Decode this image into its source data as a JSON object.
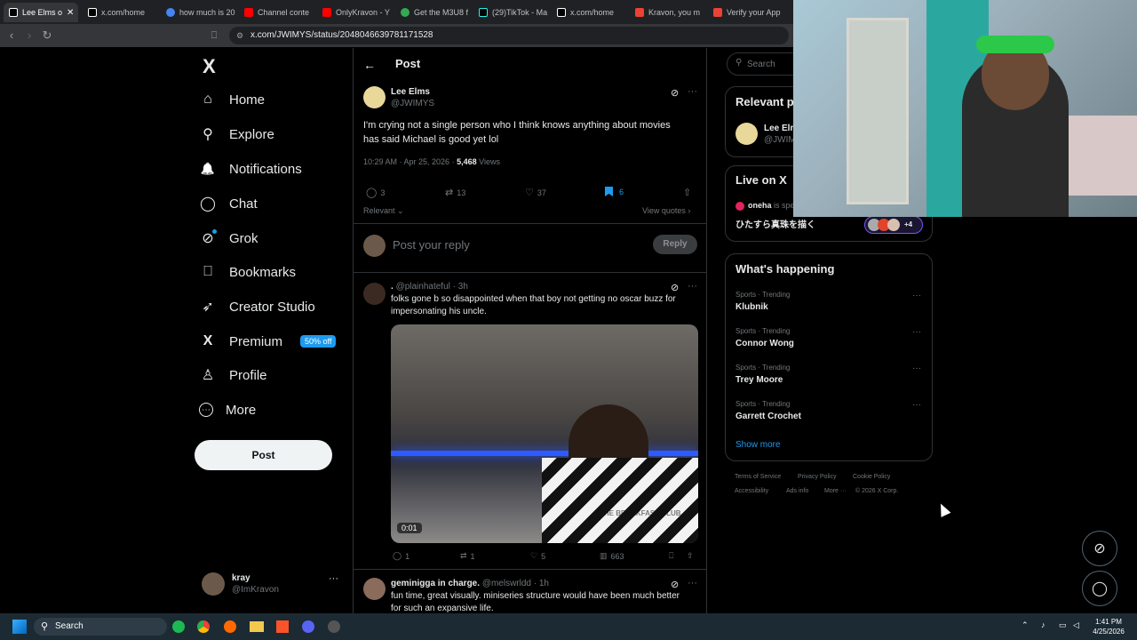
{
  "browser": {
    "tabs": [
      {
        "label": "Lee Elms o",
        "color": "#ffffff",
        "active": true
      },
      {
        "label": "x.com/home",
        "color": "#ffffff"
      },
      {
        "label": "how much is 20",
        "color": "#4285f4"
      },
      {
        "label": "Channel conte",
        "color": "#ff0000"
      },
      {
        "label": "OnlyKravon - Y",
        "color": "#ff0000"
      },
      {
        "label": "Get the M3U8 f",
        "color": "#34a853"
      },
      {
        "label": "(29)TikTok - Ma",
        "color": "#ffffff"
      },
      {
        "label": "x.com/home",
        "color": "#ffffff"
      },
      {
        "label": "Kravon, you m",
        "color": "#ea4335"
      },
      {
        "label": "Verify your App",
        "color": "#ea4335"
      }
    ],
    "url": "x.com/JWIMYS/status/2048046639781171528"
  },
  "sidebar": {
    "logo": "X",
    "items": [
      {
        "label": "Home",
        "icon": "home-icon",
        "glyph": "⌂"
      },
      {
        "label": "Explore",
        "icon": "search-icon",
        "glyph": "⚲"
      },
      {
        "label": "Notifications",
        "icon": "bell-icon",
        "glyph": "🔔"
      },
      {
        "label": "Chat",
        "icon": "chat-icon",
        "glyph": "◯"
      },
      {
        "label": "Grok",
        "icon": "grok-icon",
        "glyph": "⊘"
      },
      {
        "label": "Bookmarks",
        "icon": "bookmark-icon",
        "glyph": "⎕"
      },
      {
        "label": "Creator Studio",
        "icon": "rocket-icon",
        "glyph": "➶"
      },
      {
        "label": "Premium",
        "icon": "x-premium-icon",
        "glyph": "X"
      },
      {
        "label": "Profile",
        "icon": "person-icon",
        "glyph": "♙"
      },
      {
        "label": "More",
        "icon": "more-circle-icon",
        "glyph": "⋯"
      }
    ],
    "premium_badge": "50% off",
    "post_button": "Post",
    "account": {
      "name": "kray",
      "handle": "@ImKravon"
    }
  },
  "main": {
    "header_title": "Post",
    "post": {
      "author": "Lee Elms",
      "handle": "@JWIMYS",
      "text_line1": "I'm crying not a single person who I think knows anything  about movies",
      "text_line2": "has said Michael is good yet lol",
      "time": "10:29 AM · Apr 25, 2026 · ",
      "views_count": "5,468",
      "views_label": " Views",
      "replies": "3",
      "reposts": "13",
      "likes": "37",
      "bookmarks": "6",
      "sort_label": "Relevant",
      "view_quotes": "View quotes"
    },
    "reply_box": {
      "placeholder": "Post your reply",
      "button": "Reply"
    },
    "replies": [
      {
        "name": ".",
        "handle": "@plainhateful · 3h",
        "text_line1": "folks gone b so disappointed when that boy not getting no oscar buzz for",
        "text_line2": "impersonating his uncle.",
        "video_time": "0:01",
        "video_text": "THE BREAKFAST CLUB",
        "replies": "1",
        "reposts": "1",
        "likes": "5",
        "views": "663"
      },
      {
        "name": "geminigga in charge.",
        "handle": "@melswrldd · 1h",
        "text_line1": "fun time, great visually. miniseries structure would have been much better",
        "text_line2": "for such an expansive life."
      }
    ]
  },
  "right": {
    "search_placeholder": "Search",
    "relevant_title": "Relevant p",
    "relevant_name": "Lee Elm",
    "relevant_handle": "@JWIM",
    "live_title": "Live on X",
    "live_host": "oneha",
    "live_host_suffix": " is spe",
    "live_text": "ひたすら真珠を描く",
    "live_count": "+4",
    "happening_title": "What's happening",
    "trends": [
      {
        "category": "Sports · Trending",
        "name": "Klubnik"
      },
      {
        "category": "Sports · Trending",
        "name": "Connor Wong"
      },
      {
        "category": "Sports · Trending",
        "name": "Trey Moore"
      },
      {
        "category": "Sports · Trending",
        "name": "Garrett Crochet"
      }
    ],
    "show_more": "Show more",
    "footer": [
      "Terms of Service",
      "Privacy Policy",
      "Cookie Policy",
      "Accessibility",
      "Ads info",
      "More ···",
      "© 2026 X Corp."
    ]
  },
  "taskbar": {
    "search": "Search",
    "time": "1:41 PM",
    "date": "4/25/2026"
  },
  "colors": {
    "accent": "#1d9bf0",
    "background": "#000000",
    "border": "#2f3336",
    "muted": "#71767b"
  }
}
